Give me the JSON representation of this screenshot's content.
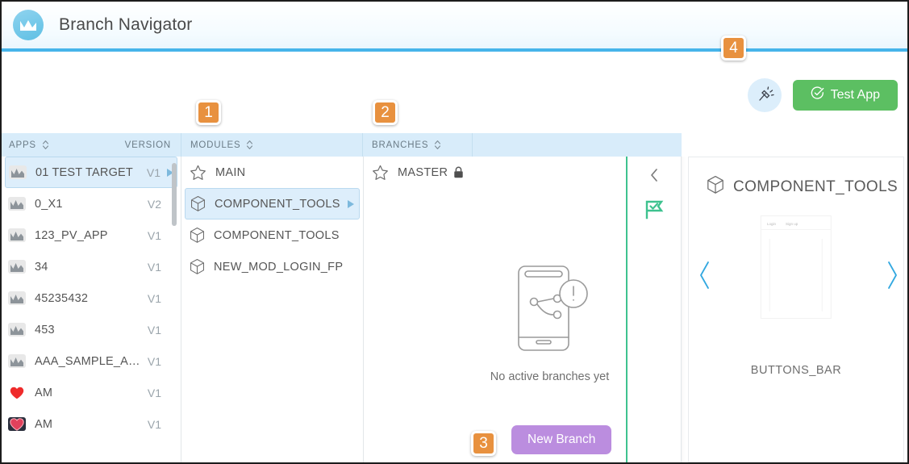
{
  "header": {
    "title": "Branch Navigator",
    "logo_icon": "mountain-chart-icon",
    "accent_color": "#46b4ea"
  },
  "toolbar": {
    "plug_icon": "plug-connector-icon",
    "test_app_label": "Test App",
    "test_app_icon": "check-circle-icon",
    "test_app_color": "#5cbf62"
  },
  "badges": [
    {
      "id": "1",
      "label": "1"
    },
    {
      "id": "2",
      "label": "2"
    },
    {
      "id": "3",
      "label": "3"
    },
    {
      "id": "4",
      "label": "4"
    }
  ],
  "badge_color": "#e8913f",
  "columns": {
    "apps": {
      "header": "APPS",
      "version_header": "VERSION",
      "sort_icon": "sort-updown-icon",
      "items": [
        {
          "name": "01 TEST TARGET",
          "version": "V1",
          "icon": "app-thumb-icon",
          "selected": true,
          "arrow": true
        },
        {
          "name": "0_X1",
          "version": "V2",
          "icon": "app-thumb-icon",
          "selected": false,
          "arrow": false
        },
        {
          "name": "123_PV_APP",
          "version": "V1",
          "icon": "app-thumb-icon",
          "selected": false,
          "arrow": false
        },
        {
          "name": "34",
          "version": "V1",
          "icon": "app-thumb-icon",
          "selected": false,
          "arrow": false
        },
        {
          "name": "45235432",
          "version": "V1",
          "icon": "app-thumb-icon",
          "selected": false,
          "arrow": false
        },
        {
          "name": "453",
          "version": "V1",
          "icon": "app-thumb-icon",
          "selected": false,
          "arrow": false
        },
        {
          "name": "AAA_SAMPLE_APP",
          "version": "V1",
          "icon": "app-thumb-icon",
          "selected": false,
          "arrow": false
        },
        {
          "name": "AM",
          "version": "V1",
          "icon": "heart-icon",
          "selected": false,
          "arrow": false
        },
        {
          "name": "AM",
          "version": "V1",
          "icon": "heart-dark-icon",
          "selected": false,
          "arrow": false
        }
      ]
    },
    "modules": {
      "header": "MODULES",
      "sort_icon": "sort-updown-icon",
      "items": [
        {
          "name": "MAIN",
          "icon": "star-icon",
          "selected": false,
          "arrow": false
        },
        {
          "name": "COMPONENT_TOOLS",
          "icon": "cube-icon",
          "selected": true,
          "arrow": true
        },
        {
          "name": "COMPONENT_TOOLS",
          "icon": "cube-icon",
          "selected": false,
          "arrow": false
        },
        {
          "name": "NEW_MOD_LOGIN_FP",
          "icon": "cube-icon",
          "selected": false,
          "arrow": false
        }
      ]
    },
    "branches": {
      "header": "BRANCHES",
      "sort_icon": "sort-updown-icon",
      "items": [
        {
          "name": "MASTER",
          "icon": "star-icon",
          "lock": true
        }
      ]
    }
  },
  "empty_state": {
    "icon": "phone-branch-alert-icon",
    "text": "No active branches yet",
    "button_label": "New Branch",
    "button_color": "#bb8ddf"
  },
  "strip": {
    "collapse_icon": "chevron-left-icon",
    "flag_icon": "flag-check-icon",
    "flag_color": "#3ec28f"
  },
  "preview": {
    "title": "COMPONENT_TOOLS",
    "title_icon": "cube-icon",
    "prev_icon": "chevron-left-icon",
    "next_icon": "chevron-right-icon",
    "screen_label": "BUTTONS_BAR",
    "thumb_tabs": [
      "Login",
      "Sign up"
    ]
  }
}
